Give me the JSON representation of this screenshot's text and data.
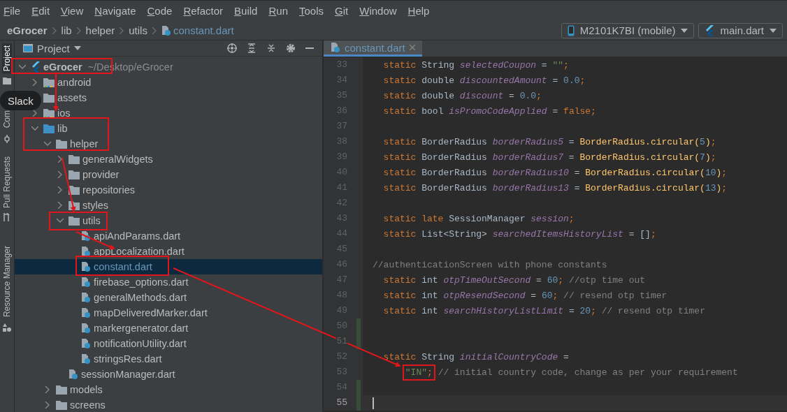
{
  "menu_bar": [
    "File",
    "Edit",
    "View",
    "Navigate",
    "Code",
    "Refactor",
    "Build",
    "Run",
    "Tools",
    "Git",
    "Window",
    "Help"
  ],
  "breadcrumbs": [
    {
      "label": "eGrocer",
      "kind": "project"
    },
    {
      "label": "lib",
      "kind": "folder"
    },
    {
      "label": "helper",
      "kind": "folder"
    },
    {
      "label": "utils",
      "kind": "folder"
    },
    {
      "label": "constant.dart",
      "kind": "file"
    }
  ],
  "device_selector": {
    "label": "M2101K7BI (mobile)"
  },
  "run_config": {
    "label": "main.dart"
  },
  "tool_strip": [
    {
      "label": "Project",
      "kind": "project",
      "selected": true
    },
    {
      "label": "Com",
      "kind": "commit",
      "selected": false
    },
    {
      "label": "Pull Requests",
      "kind": "pull",
      "selected": false
    },
    {
      "label": "Resource Manager",
      "kind": "resource",
      "selected": false
    }
  ],
  "tooltip": {
    "text": "Slack"
  },
  "project_panel": {
    "title": "Project",
    "tree": [
      {
        "label": "eGrocer",
        "path": "~/Desktop/eGrocer",
        "kind": "root",
        "expanded": true,
        "selected": false,
        "children": [
          {
            "label": "android",
            "kind": "module",
            "expanded": false,
            "selected": false
          },
          {
            "label": "assets",
            "kind": "folder",
            "expanded": false,
            "selected": false
          },
          {
            "label": "ios",
            "kind": "module",
            "expanded": false,
            "selected": false
          },
          {
            "label": "lib",
            "kind": "source",
            "expanded": true,
            "selected": false,
            "children": [
              {
                "label": "helper",
                "kind": "folder",
                "expanded": true,
                "selected": false,
                "children": [
                  {
                    "label": "generalWidgets",
                    "kind": "folder",
                    "expanded": false,
                    "selected": false
                  },
                  {
                    "label": "provider",
                    "kind": "folder",
                    "expanded": false,
                    "selected": false
                  },
                  {
                    "label": "repositories",
                    "kind": "folder",
                    "expanded": false,
                    "selected": false
                  },
                  {
                    "label": "styles",
                    "kind": "folder",
                    "expanded": false,
                    "selected": false
                  },
                  {
                    "label": "utils",
                    "kind": "folder",
                    "expanded": true,
                    "selected": false,
                    "children": [
                      {
                        "label": "apiAndParams.dart",
                        "kind": "file",
                        "selected": false
                      },
                      {
                        "label": "appLocalization.dart",
                        "kind": "file",
                        "selected": false
                      },
                      {
                        "label": "constant.dart",
                        "kind": "file",
                        "selected": true
                      },
                      {
                        "label": "firebase_options.dart",
                        "kind": "file",
                        "selected": false
                      },
                      {
                        "label": "generalMethods.dart",
                        "kind": "file",
                        "selected": false
                      },
                      {
                        "label": "mapDeliveredMarker.dart",
                        "kind": "file",
                        "selected": false
                      },
                      {
                        "label": "markergenerator.dart",
                        "kind": "file",
                        "selected": false
                      },
                      {
                        "label": "notificationUtility.dart",
                        "kind": "file",
                        "selected": false
                      },
                      {
                        "label": "stringsRes.dart",
                        "kind": "file",
                        "selected": false
                      }
                    ]
                  },
                  {
                    "label": "sessionManager.dart",
                    "kind": "file",
                    "selected": false
                  }
                ]
              },
              {
                "label": "models",
                "kind": "folder",
                "expanded": false,
                "selected": false
              },
              {
                "label": "screens",
                "kind": "folder",
                "expanded": false,
                "selected": false
              }
            ]
          }
        ]
      }
    ]
  },
  "editor": {
    "tabs": [
      {
        "label": "constant.dart",
        "selected": true
      }
    ],
    "lines": [
      {
        "number": "33",
        "changed": false,
        "current": false,
        "tokens": [
          {
            "kind": "kw",
            "text": "  static"
          },
          {
            "kind": "plain",
            "text": " String "
          },
          {
            "kind": "field",
            "text": "selectedCoupon"
          },
          {
            "kind": "plain",
            "text": " = "
          },
          {
            "kind": "str",
            "text": "\"\""
          },
          {
            "kind": "kw",
            "text": ";"
          }
        ]
      },
      {
        "number": "34",
        "changed": false,
        "current": false,
        "tokens": [
          {
            "kind": "kw",
            "text": "  static"
          },
          {
            "kind": "plain",
            "text": " double "
          },
          {
            "kind": "field",
            "text": "discountedAmount"
          },
          {
            "kind": "plain",
            "text": " = "
          },
          {
            "kind": "num",
            "text": "0.0"
          },
          {
            "kind": "kw",
            "text": ";"
          }
        ]
      },
      {
        "number": "35",
        "changed": false,
        "current": false,
        "tokens": [
          {
            "kind": "kw",
            "text": "  static"
          },
          {
            "kind": "plain",
            "text": " double "
          },
          {
            "kind": "field",
            "text": "discount"
          },
          {
            "kind": "plain",
            "text": " = "
          },
          {
            "kind": "num",
            "text": "0.0"
          },
          {
            "kind": "kw",
            "text": ";"
          }
        ]
      },
      {
        "number": "36",
        "changed": false,
        "current": false,
        "tokens": [
          {
            "kind": "kw",
            "text": "  static"
          },
          {
            "kind": "plain",
            "text": " bool "
          },
          {
            "kind": "field",
            "text": "isPromoCodeApplied"
          },
          {
            "kind": "plain",
            "text": " = "
          },
          {
            "kind": "kw",
            "text": "false;"
          }
        ]
      },
      {
        "number": "37",
        "changed": false,
        "current": false
      },
      {
        "number": "38",
        "changed": false,
        "current": false,
        "tokens": [
          {
            "kind": "kw",
            "text": "  static"
          },
          {
            "kind": "plain",
            "text": " BorderRadius "
          },
          {
            "kind": "field",
            "text": "borderRadius5"
          },
          {
            "kind": "plain",
            "text": " = "
          },
          {
            "kind": "method",
            "text": "BorderRadius.circular("
          },
          {
            "kind": "num",
            "text": "5"
          },
          {
            "kind": "method",
            "text": ")"
          },
          {
            "kind": "kw",
            "text": ";"
          }
        ]
      },
      {
        "number": "39",
        "changed": false,
        "current": false,
        "tokens": [
          {
            "kind": "kw",
            "text": "  static"
          },
          {
            "kind": "plain",
            "text": " BorderRadius "
          },
          {
            "kind": "field",
            "text": "borderRadius7"
          },
          {
            "kind": "plain",
            "text": " = "
          },
          {
            "kind": "method",
            "text": "BorderRadius.circular("
          },
          {
            "kind": "num",
            "text": "7"
          },
          {
            "kind": "method",
            "text": ")"
          },
          {
            "kind": "kw",
            "text": ";"
          }
        ]
      },
      {
        "number": "40",
        "changed": false,
        "current": false,
        "tokens": [
          {
            "kind": "kw",
            "text": "  static"
          },
          {
            "kind": "plain",
            "text": " BorderRadius "
          },
          {
            "kind": "field",
            "text": "borderRadius10"
          },
          {
            "kind": "plain",
            "text": " = "
          },
          {
            "kind": "method",
            "text": "BorderRadius.circular("
          },
          {
            "kind": "num",
            "text": "10"
          },
          {
            "kind": "method",
            "text": ")"
          },
          {
            "kind": "kw",
            "text": ";"
          }
        ]
      },
      {
        "number": "41",
        "changed": false,
        "current": false,
        "tokens": [
          {
            "kind": "kw",
            "text": "  static"
          },
          {
            "kind": "plain",
            "text": " BorderRadius "
          },
          {
            "kind": "field",
            "text": "borderRadius13"
          },
          {
            "kind": "plain",
            "text": " = "
          },
          {
            "kind": "method",
            "text": "BorderRadius.circular("
          },
          {
            "kind": "num",
            "text": "13"
          },
          {
            "kind": "method",
            "text": ")"
          },
          {
            "kind": "kw",
            "text": ";"
          }
        ]
      },
      {
        "number": "42",
        "changed": false,
        "current": false
      },
      {
        "number": "43",
        "changed": false,
        "current": false,
        "tokens": [
          {
            "kind": "kw",
            "text": "  static late"
          },
          {
            "kind": "plain",
            "text": " SessionManager "
          },
          {
            "kind": "field",
            "text": "session"
          },
          {
            "kind": "kw",
            "text": ";"
          }
        ]
      },
      {
        "number": "44",
        "changed": false,
        "current": false,
        "tokens": [
          {
            "kind": "kw",
            "text": "  static"
          },
          {
            "kind": "plain",
            "text": " List<String> "
          },
          {
            "kind": "field",
            "text": "searchedItemsHistoryList"
          },
          {
            "kind": "plain",
            "text": " = []"
          },
          {
            "kind": "kw",
            "text": ";"
          }
        ]
      },
      {
        "number": "45",
        "changed": false,
        "current": false
      },
      {
        "number": "46",
        "changed": false,
        "current": false,
        "tokens": [
          {
            "kind": "comment",
            "text": "//authenticationScreen with phone constants"
          }
        ]
      },
      {
        "number": "47",
        "changed": false,
        "current": false,
        "tokens": [
          {
            "kind": "kw",
            "text": "  static"
          },
          {
            "kind": "plain",
            "text": " int "
          },
          {
            "kind": "field",
            "text": "otpTimeOutSecond"
          },
          {
            "kind": "plain",
            "text": " = "
          },
          {
            "kind": "num",
            "text": "60"
          },
          {
            "kind": "kw",
            "text": ";"
          },
          {
            "kind": "comment",
            "text": " //otp time out"
          }
        ]
      },
      {
        "number": "48",
        "changed": false,
        "current": false,
        "tokens": [
          {
            "kind": "kw",
            "text": "  static"
          },
          {
            "kind": "plain",
            "text": " int "
          },
          {
            "kind": "field",
            "text": "otpResendSecond"
          },
          {
            "kind": "plain",
            "text": " = "
          },
          {
            "kind": "num",
            "text": "60"
          },
          {
            "kind": "kw",
            "text": ";"
          },
          {
            "kind": "comment",
            "text": " // resend otp timer"
          }
        ]
      },
      {
        "number": "49",
        "changed": false,
        "current": false,
        "tokens": [
          {
            "kind": "kw",
            "text": "  static"
          },
          {
            "kind": "plain",
            "text": " int "
          },
          {
            "kind": "field",
            "text": "searchHistoryListLimit"
          },
          {
            "kind": "plain",
            "text": " = "
          },
          {
            "kind": "num",
            "text": "20"
          },
          {
            "kind": "kw",
            "text": ";"
          },
          {
            "kind": "comment",
            "text": " // resend otp timer"
          }
        ]
      },
      {
        "number": "50",
        "changed": true,
        "current": false
      },
      {
        "number": "51",
        "changed": true,
        "current": false
      },
      {
        "number": "52",
        "changed": false,
        "current": false,
        "tokens": [
          {
            "kind": "kw",
            "text": "  static"
          },
          {
            "kind": "plain",
            "text": " String "
          },
          {
            "kind": "field",
            "text": "initialCountryCode"
          },
          {
            "kind": "plain",
            "text": " ="
          }
        ]
      },
      {
        "number": "53",
        "changed": false,
        "current": false,
        "tokens": [
          {
            "kind": "str",
            "text": "\"IN\"",
            "boxed": true
          },
          {
            "kind": "kw",
            "text": ";",
            "boxed": true
          },
          {
            "kind": "comment",
            "text": " // initial country code, change as per your requirement",
            "boxed": false
          }
        ]
      },
      {
        "number": "54",
        "changed": true,
        "current": false
      },
      {
        "number": "55",
        "changed": true,
        "current": true
      }
    ]
  }
}
